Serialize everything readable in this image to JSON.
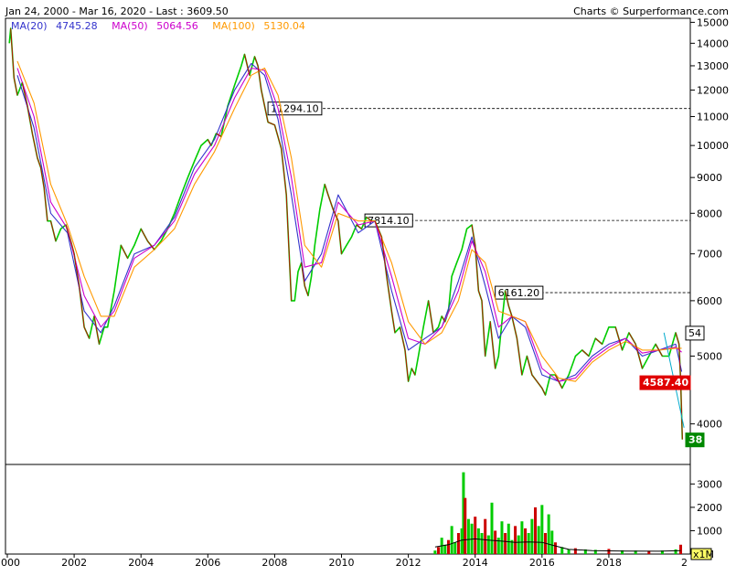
{
  "header": {
    "range_label": "Jan 24, 2000 - Mar 16, 2020 - Last : 3609.50",
    "ma20_label": "MA(20)",
    "ma20_value": "4745.28",
    "ma50_label": "MA(50)",
    "ma50_value": "5064.56",
    "ma100_label": "MA(100)",
    "ma100_value": "5130.04",
    "credit": "Charts © Surperformance.com"
  },
  "colors": {
    "ma20": "#3333cc",
    "ma50": "#cc00cc",
    "ma100": "#ff9900",
    "price_up": "#00cc00",
    "price_down": "#cc0000",
    "badge_red": "#e00000",
    "badge_green": "#008800",
    "trend": "#00aacc"
  },
  "chart_data": [
    {
      "type": "line",
      "title": "",
      "scale": "log",
      "ylim": [
        3500,
        15200
      ],
      "xlim": [
        2000.0,
        2020.3
      ],
      "y_ticks": [
        4000,
        5000,
        6000,
        7000,
        8000,
        9000,
        10000,
        11000,
        12000,
        13000,
        14000,
        15000
      ],
      "x_ticks": [
        2000,
        2002,
        2004,
        2006,
        2008,
        2010,
        2012,
        2014,
        2016,
        2018
      ],
      "x_tick_labels": [
        "2000",
        "2002",
        "2004",
        "2006",
        "2008",
        "2010",
        "2012",
        "2014",
        "2016",
        "2018"
      ],
      "x_edge_label": "2",
      "grid": false,
      "series": [
        {
          "name": "Price",
          "x": [
            2000.06,
            2000.1,
            2000.2,
            2000.3,
            2000.45,
            2000.6,
            2000.75,
            2000.9,
            2001.0,
            2001.1,
            2001.2,
            2001.3,
            2001.45,
            2001.6,
            2001.75,
            2001.9,
            2002.0,
            2002.15,
            2002.3,
            2002.45,
            2002.6,
            2002.75,
            2002.9,
            2003.0,
            2003.2,
            2003.4,
            2003.6,
            2003.8,
            2004.0,
            2004.2,
            2004.4,
            2004.6,
            2004.8,
            2005.0,
            2005.2,
            2005.4,
            2005.6,
            2005.8,
            2006.0,
            2006.1,
            2006.25,
            2006.4,
            2006.6,
            2006.8,
            2007.0,
            2007.1,
            2007.25,
            2007.4,
            2007.5,
            2007.6,
            2007.8,
            2008.0,
            2008.2,
            2008.35,
            2008.5,
            2008.6,
            2008.7,
            2008.8,
            2008.9,
            2009.0,
            2009.1,
            2009.2,
            2009.35,
            2009.5,
            2009.6,
            2009.75,
            2009.9,
            2010.0,
            2010.15,
            2010.3,
            2010.45,
            2010.6,
            2010.75,
            2010.9,
            2011.0,
            2011.2,
            2011.35,
            2011.5,
            2011.6,
            2011.75,
            2011.9,
            2012.0,
            2012.1,
            2012.2,
            2012.3,
            2012.45,
            2012.6,
            2012.75,
            2012.9,
            2013.0,
            2013.1,
            2013.2,
            2013.3,
            2013.45,
            2013.6,
            2013.75,
            2013.9,
            2014.0,
            2014.1,
            2014.2,
            2014.3,
            2014.45,
            2014.6,
            2014.7,
            2014.8,
            2014.9,
            2015.0,
            2015.1,
            2015.25,
            2015.4,
            2015.55,
            2015.7,
            2015.85,
            2016.0,
            2016.1,
            2016.25,
            2016.4,
            2016.6,
            2016.8,
            2017.0,
            2017.2,
            2017.4,
            2017.6,
            2017.8,
            2018.0,
            2018.2,
            2018.4,
            2018.6,
            2018.8,
            2019.0,
            2019.2,
            2019.4,
            2019.6,
            2019.8,
            2020.0,
            2020.1,
            2020.15,
            2020.2
          ],
          "values": [
            14000,
            14700,
            12500,
            11800,
            12300,
            11400,
            10400,
            9600,
            9300,
            8700,
            7800,
            7800,
            7300,
            7600,
            7700,
            7300,
            7000,
            6300,
            5500,
            5300,
            5700,
            5200,
            5500,
            5500,
            6200,
            7200,
            6900,
            7200,
            7600,
            7300,
            7100,
            7300,
            7600,
            8000,
            8500,
            9000,
            9500,
            10000,
            10200,
            10000,
            10400,
            10300,
            11400,
            12200,
            13000,
            13500,
            12600,
            13400,
            13000,
            12000,
            10800,
            10700,
            9900,
            8500,
            6000,
            6000,
            6600,
            6800,
            6300,
            6100,
            6500,
            7200,
            8100,
            8800,
            8500,
            8100,
            7800,
            7000,
            7200,
            7400,
            7700,
            7600,
            7900,
            7800,
            7800,
            7400,
            6500,
            5800,
            5400,
            5500,
            5100,
            4600,
            4800,
            4700,
            5000,
            5500,
            6000,
            5400,
            5500,
            5700,
            5600,
            5800,
            6500,
            6800,
            7100,
            7600,
            7700,
            7200,
            6200,
            6000,
            5000,
            5600,
            4800,
            5000,
            5600,
            6200,
            5900,
            5700,
            5300,
            4700,
            5000,
            4700,
            4600,
            4500,
            4400,
            4700,
            4700,
            4500,
            4700,
            5000,
            5100,
            5000,
            5300,
            5200,
            5500,
            5500,
            5100,
            5400,
            5200,
            4800,
            5000,
            5200,
            5000,
            5000,
            5400,
            5200,
            4600,
            3800
          ]
        },
        {
          "name": "MA(20)",
          "x": [
            2000.3,
            2000.8,
            2001.3,
            2001.8,
            2002.3,
            2002.8,
            2003.2,
            2003.8,
            2004.4,
            2005.0,
            2005.6,
            2006.2,
            2006.8,
            2007.3,
            2007.7,
            2008.1,
            2008.5,
            2008.9,
            2009.4,
            2009.9,
            2010.5,
            2011.0,
            2011.5,
            2012.0,
            2012.5,
            2013.0,
            2013.5,
            2013.9,
            2014.3,
            2014.7,
            2015.1,
            2015.5,
            2016.0,
            2016.5,
            2017.0,
            2017.5,
            2018.0,
            2018.5,
            2019.0,
            2019.5,
            2020.0,
            2020.18
          ],
          "values": [
            12600,
            10600,
            8000,
            7500,
            5800,
            5400,
            5900,
            7000,
            7200,
            7900,
            9300,
            10200,
            12000,
            13100,
            12600,
            10900,
            8500,
            6400,
            7000,
            8500,
            7500,
            7800,
            6200,
            5100,
            5300,
            5500,
            6400,
            7400,
            6300,
            5300,
            5700,
            5500,
            4700,
            4600,
            4700,
            5000,
            5200,
            5300,
            5000,
            5100,
            5200,
            4750
          ]
        },
        {
          "name": "MA(50)",
          "x": [
            2000.3,
            2000.8,
            2001.3,
            2001.8,
            2002.3,
            2002.8,
            2003.2,
            2003.8,
            2004.4,
            2005.0,
            2005.6,
            2006.2,
            2006.8,
            2007.3,
            2007.7,
            2008.1,
            2008.5,
            2008.9,
            2009.4,
            2009.9,
            2010.5,
            2011.0,
            2011.5,
            2012.0,
            2012.5,
            2013.0,
            2013.5,
            2013.9,
            2014.3,
            2014.7,
            2015.1,
            2015.5,
            2016.0,
            2016.5,
            2017.0,
            2017.5,
            2018.0,
            2018.5,
            2019.0,
            2019.5,
            2020.0,
            2020.18
          ],
          "values": [
            12900,
            11000,
            8300,
            7600,
            6100,
            5500,
            5800,
            6900,
            7200,
            7800,
            9100,
            10000,
            11700,
            12900,
            12800,
            11300,
            9000,
            6700,
            6800,
            8300,
            7700,
            7800,
            6500,
            5300,
            5200,
            5500,
            6200,
            7300,
            6600,
            5500,
            5700,
            5600,
            4800,
            4600,
            4650,
            4950,
            5150,
            5300,
            5050,
            5100,
            5150,
            5065
          ]
        },
        {
          "name": "MA(100)",
          "x": [
            2000.3,
            2000.8,
            2001.3,
            2001.8,
            2002.3,
            2002.8,
            2003.2,
            2003.8,
            2004.4,
            2005.0,
            2005.6,
            2006.2,
            2006.8,
            2007.3,
            2007.7,
            2008.1,
            2008.5,
            2008.9,
            2009.4,
            2009.9,
            2010.5,
            2011.0,
            2011.5,
            2012.0,
            2012.5,
            2013.0,
            2013.5,
            2013.9,
            2014.3,
            2014.7,
            2015.1,
            2015.5,
            2016.0,
            2016.5,
            2017.0,
            2017.5,
            2018.0,
            2018.5,
            2019.0,
            2019.5,
            2020.0,
            2020.18
          ],
          "values": [
            13200,
            11500,
            8800,
            7700,
            6500,
            5700,
            5700,
            6700,
            7100,
            7600,
            8800,
            9800,
            11300,
            12600,
            12900,
            11800,
            9600,
            7200,
            6700,
            8000,
            7800,
            7800,
            6800,
            5600,
            5200,
            5400,
            6000,
            7100,
            6800,
            5800,
            5700,
            5600,
            5000,
            4650,
            4600,
            4900,
            5100,
            5250,
            5100,
            5100,
            5130,
            5130
          ]
        }
      ],
      "levels": [
        {
          "label": "11294.10",
          "value": 11294.1,
          "x_start": 2007.8
        },
        {
          "label": "7814.10",
          "value": 7814.1,
          "x_start": 2010.7
        },
        {
          "label": "6161.20",
          "value": 6161.2,
          "x_start": 2014.6
        }
      ],
      "trendline": {
        "x": [
          2019.65,
          2020.25
        ],
        "values": [
          5400,
          3950
        ]
      },
      "badges": [
        {
          "label": "54",
          "value": 5400,
          "style": "white"
        },
        {
          "label": "4587.40",
          "value": 4587.4,
          "style": "red"
        },
        {
          "label": "38",
          "value": 3800,
          "style": "green"
        }
      ]
    },
    {
      "type": "bar",
      "title": "",
      "ylim": [
        0,
        3600
      ],
      "y_ticks": [
        1000,
        2000,
        3000
      ],
      "unit_label": "x1M",
      "x": [
        2012.8,
        2012.9,
        2013.0,
        2013.1,
        2013.2,
        2013.3,
        2013.4,
        2013.5,
        2013.6,
        2013.65,
        2013.7,
        2013.8,
        2013.9,
        2014.0,
        2014.1,
        2014.2,
        2014.3,
        2014.4,
        2014.5,
        2014.6,
        2014.7,
        2014.8,
        2014.9,
        2015.0,
        2015.1,
        2015.2,
        2015.3,
        2015.4,
        2015.5,
        2015.6,
        2015.7,
        2015.8,
        2015.9,
        2016.0,
        2016.1,
        2016.2,
        2016.3,
        2016.4,
        2016.6,
        2016.8,
        2017.0,
        2017.3,
        2017.6,
        2018.0,
        2018.4,
        2018.8,
        2019.2,
        2019.6,
        2020.0,
        2020.15
      ],
      "values": [
        150,
        300,
        700,
        400,
        600,
        1200,
        500,
        900,
        1100,
        3500,
        2400,
        1500,
        1300,
        1600,
        1100,
        900,
        1500,
        800,
        2200,
        1000,
        700,
        1400,
        900,
        1300,
        600,
        1200,
        800,
        1400,
        1100,
        900,
        1500,
        2000,
        1200,
        2100,
        900,
        1700,
        1000,
        500,
        300,
        200,
        250,
        200,
        180,
        220,
        160,
        150,
        140,
        150,
        200,
        400
      ],
      "line_x": [
        2012.8,
        2013.2,
        2013.6,
        2014.0,
        2014.4,
        2014.8,
        2015.2,
        2015.6,
        2016.0,
        2016.4,
        2016.8,
        2017.5,
        2018.5,
        2019.5,
        2020.15
      ],
      "line_values": [
        300,
        400,
        600,
        650,
        600,
        550,
        500,
        520,
        500,
        350,
        200,
        150,
        130,
        120,
        150
      ]
    }
  ]
}
